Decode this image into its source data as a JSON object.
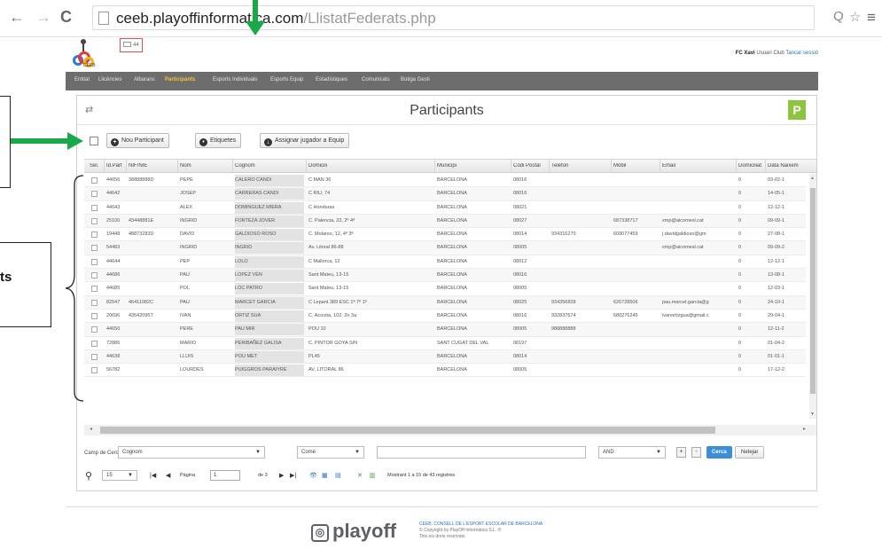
{
  "browser": {
    "url_prefix": "ceeb.playoffinformatica",
    "url_domain": ".com",
    "url_path": "/LlistatFederats.php",
    "back": "←",
    "forward": "→",
    "reload": "C",
    "zoom": "Q",
    "star": "☆",
    "menu": "≡"
  },
  "header": {
    "logo_text": "CEEB",
    "mail_count": "44",
    "user_name": "FC Xavi",
    "user_role": "Usuari Club",
    "logout": "Tancar sessió"
  },
  "nav": [
    {
      "label": "Entitat",
      "active": false
    },
    {
      "label": "Llicències",
      "active": false
    },
    {
      "label": "Albarans",
      "active": false
    },
    {
      "label": "Participants",
      "active": true
    },
    {
      "label": "Esports Individuals",
      "active": false
    },
    {
      "label": "Esports Equip",
      "active": false
    },
    {
      "label": "Estadístiques",
      "active": false
    },
    {
      "label": "Comunicats",
      "active": false
    },
    {
      "label": "Botiga Gesti",
      "active": false
    }
  ],
  "panel": {
    "title": "Participants",
    "badge": "P",
    "filter_icon": "⇄",
    "toolbar": {
      "new_label": "Nou Participant",
      "labels_label": "Etiquetes",
      "assign_label": "Assignar jugador a Equip"
    }
  },
  "annotation": {
    "label_fragment": "ts"
  },
  "grid": {
    "columns": [
      "Sel.",
      "Id.Part",
      "NIF/NIE",
      "Nom",
      "Cognom",
      "Domicili",
      "Municipi",
      "Codi Postal",
      "Telèfon",
      "Mòbil",
      "Email",
      "Domiciliat",
      "Data Naixem"
    ],
    "rows": [
      [
        "44656",
        "38888888D",
        "PEPE",
        "CALERO CANDI",
        "C MAN 36",
        "BARCELONA",
        "08016",
        "",
        "",
        "",
        "0",
        "03-02-1"
      ],
      [
        "44642",
        "",
        "JOSEP",
        "CARRERAS CANDI",
        "C RIU, 74",
        "BARCELONA",
        "08016",
        "",
        "",
        "",
        "0",
        "14-05-1"
      ],
      [
        "44643",
        "",
        "ALEX",
        "DOMINGUEZ MIERA",
        "C Honduras",
        "BARCELONA",
        "08021",
        "",
        "",
        "",
        "0",
        "12-12-1"
      ],
      [
        "25100",
        "43448881E",
        "INGRID",
        "FORTEZA JOVER",
        "C. Palencia, 33, 2º 4ª",
        "BARCELONA",
        "08027",
        "",
        "687338717",
        "xmp@aicomesl.cat",
        "0",
        "09-09-1"
      ],
      [
        "19448",
        "48873283D",
        "DAVID",
        "GALDIOSO ROSO",
        "C. Molares, 12, 4º 3ª",
        "BARCELONA",
        "08014",
        "934316270",
        "609077459",
        "j.davidgaldioso@gm",
        "0",
        "27-08-1"
      ],
      [
        "54483",
        "",
        "INGRID",
        "INGRID",
        "Av. Litoral 86-88",
        "BARCELONA",
        "08005",
        "",
        "",
        "xmp@aicomesl.cat",
        "0",
        "09-09-2"
      ],
      [
        "44644",
        "",
        "PEP",
        "LOLO",
        "C Mallorca, 12",
        "BARCELONA",
        "08012",
        "",
        "",
        "",
        "0",
        "12-12-1"
      ],
      [
        "44686",
        "",
        "PAU",
        "LOPEZ VEN",
        "Sant Mateu, 13-15",
        "BARCELONA",
        "08016",
        "",
        "",
        "",
        "0",
        "13-08-1"
      ],
      [
        "44685",
        "",
        "POL",
        "LOC PATRO",
        "Sant Mateu, 13-15",
        "BARCELONA",
        "08005",
        "",
        "",
        "",
        "0",
        "12-03-1"
      ],
      [
        "82547",
        "46411082C",
        "PAU",
        "MARCET GARCIA",
        "C Lepant 389 ESC 1ª 7º 1ª",
        "BARCELONA",
        "08025",
        "934356828",
        "626728506",
        "pau.marcet.garcia@g",
        "0",
        "24-10-1"
      ],
      [
        "20696",
        "43542095T",
        "IVAN",
        "ORTIZ SUA",
        "C. Acoutia, 102, 2n 3a",
        "BARCELONA",
        "08016",
        "932837674",
        "680276245",
        "ivanortizgua@gmail.c",
        "0",
        "29-04-1"
      ],
      [
        "44650",
        "",
        "PERE",
        "PAU MIR",
        "POU 10",
        "BARCELONA",
        "08005",
        "988888888",
        "",
        "",
        "0",
        "12-11-2"
      ],
      [
        "72886",
        "",
        "MARIO",
        "PERIBAÑEZ GALISA",
        "C. PINTOR GOYA S/N",
        "SANT CUGAT DEL VAL",
        "08197",
        "",
        "",
        "",
        "0",
        "01-04-2"
      ],
      [
        "44638",
        "",
        "LLUIS",
        "POU MET",
        "PL45",
        "BARCELONA",
        "08014",
        "",
        "",
        "",
        "0",
        "01-01-1"
      ],
      [
        "56782",
        "",
        "LOURDES",
        "PUIGGROS PARAIYRE",
        "AV. LITORAL 86",
        "BARCELONA",
        "08005",
        "",
        "",
        "",
        "0",
        "17-12-2"
      ]
    ]
  },
  "search": {
    "field_label": "Camp de Cerca",
    "field_value": "Cognom",
    "op_value": "Comè",
    "text_value": "",
    "logic_value": "AND",
    "plus": "+",
    "minus": "-",
    "search_label": "Cerca",
    "clear_label": "Netejar"
  },
  "pager": {
    "page_size": "15",
    "page_label": "Pàgina",
    "page_value": "1",
    "of_label": "de 3",
    "status": "Mostrant 1 a 15 de 43 registres"
  },
  "footer": {
    "brand": "playoff",
    "line1": "CEEB. CONSELL DE L'ESPORT ESCOLAR DE BARCELONA",
    "line2": "© Copyright by PlayOff Informàtica S.L. ®",
    "line3": "Tots els drets reservats."
  }
}
